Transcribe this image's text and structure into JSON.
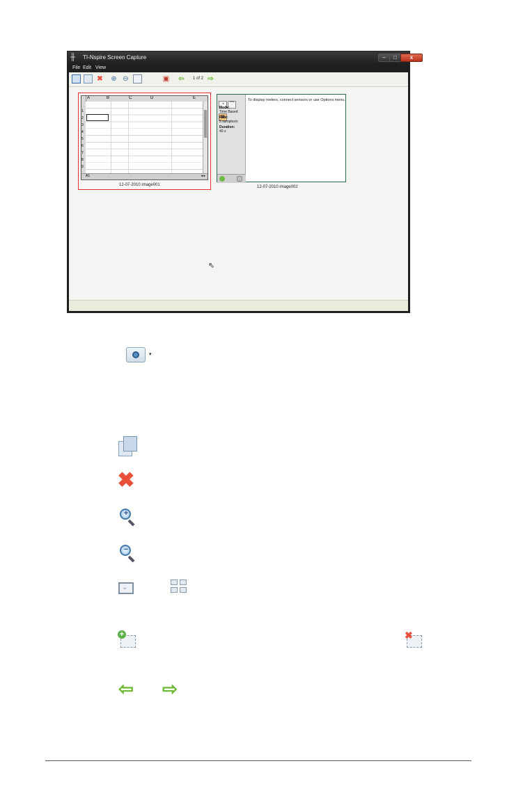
{
  "window": {
    "title": "TI-Nspire Screen Capture",
    "controls": {
      "minimize": "–",
      "maximize": "□",
      "close": "x"
    },
    "menu": [
      "File",
      "Edit",
      "View"
    ],
    "toolbar": {
      "page_counter": "1 of 2",
      "icons": [
        "save-icon",
        "tile-view-icon",
        "delete-icon",
        "zoom-in-icon",
        "zoom-out-icon",
        "fit-icon",
        "add-border-icon",
        "previous-arrow-icon",
        "next-arrow-icon"
      ]
    },
    "thumbnails": [
      {
        "caption": "12-07-2010 image001",
        "selected": true,
        "column_labels": [
          "A",
          "B",
          "C",
          "D",
          "E"
        ],
        "row_labels": [
          "1",
          "2",
          "3",
          "4",
          "5",
          "6",
          "7",
          "8",
          "9"
        ],
        "footer_cell": "A1"
      },
      {
        "caption": "12-07-2010 image002",
        "message": "To display meters, connect sensors or use Options menu.",
        "fields": [
          {
            "label": "Mode:",
            "value": "Time Based"
          },
          {
            "label": "Rate:",
            "value": "5 samples/s"
          },
          {
            "label": "Duration:",
            "value": "40 s"
          }
        ]
      }
    ]
  },
  "reference_icons": [
    "capture-camera-icon",
    "copy-pages-icon",
    "delete-icon",
    "zoom-in-icon",
    "zoom-out-icon",
    "fit-to-window-icon",
    "tile-view-icon",
    "add-border-icon",
    "remove-border-icon",
    "previous-arrow-icon",
    "next-arrow-icon"
  ],
  "colors": {
    "selection_border": "#e03030",
    "accent_green": "#6cb832",
    "delete_red": "#e8503a"
  }
}
